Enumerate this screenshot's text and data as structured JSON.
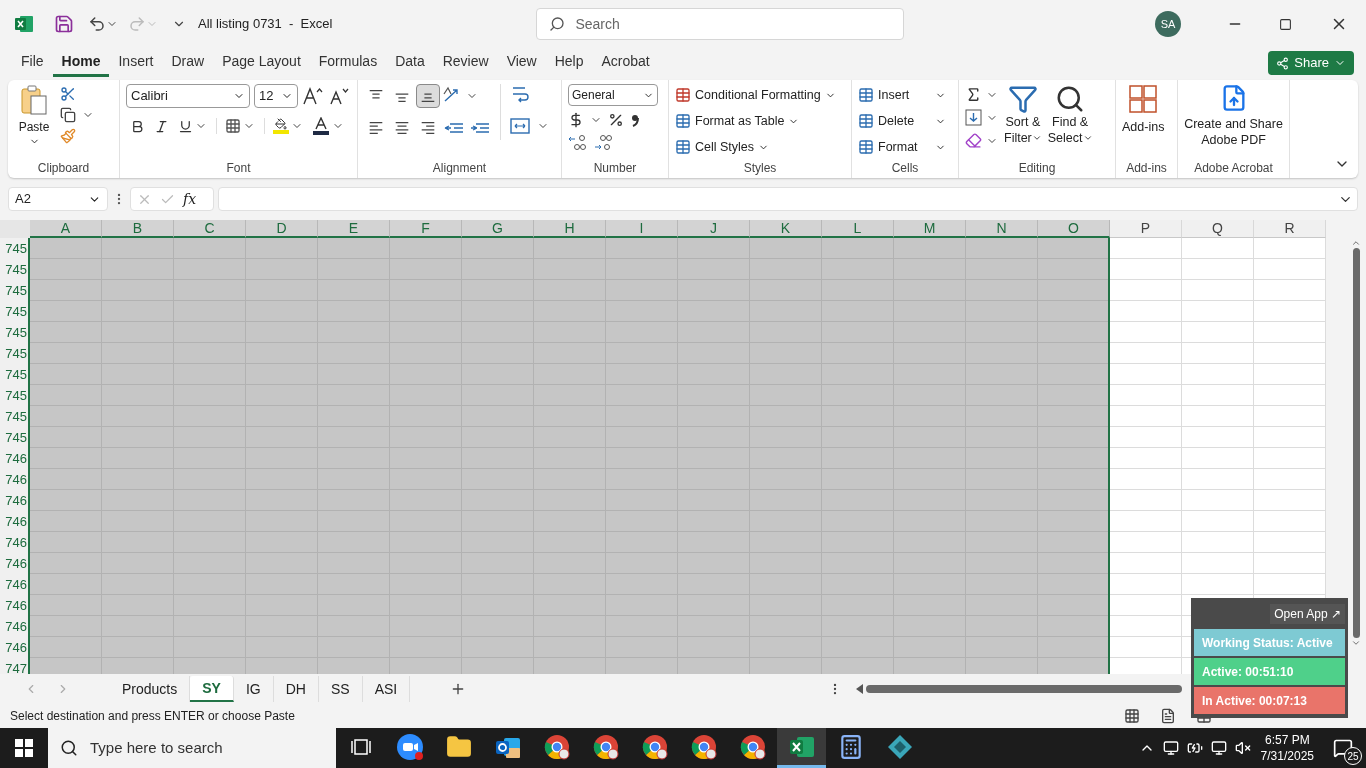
{
  "title_bar": {
    "title": "All listing 0731  -  Excel",
    "search_placeholder": "Search",
    "account_initials": "SA"
  },
  "menu_tabs": [
    {
      "label": "File",
      "selected": false
    },
    {
      "label": "Home",
      "selected": true
    },
    {
      "label": "Insert",
      "selected": false
    },
    {
      "label": "Draw",
      "selected": false
    },
    {
      "label": "Page Layout",
      "selected": false
    },
    {
      "label": "Formulas",
      "selected": false
    },
    {
      "label": "Data",
      "selected": false
    },
    {
      "label": "Review",
      "selected": false
    },
    {
      "label": "View",
      "selected": false
    },
    {
      "label": "Help",
      "selected": false
    },
    {
      "label": "Acrobat",
      "selected": false
    }
  ],
  "share_button": "Share",
  "ribbon": {
    "clipboard": {
      "paste": "Paste",
      "label": "Clipboard"
    },
    "font": {
      "font_name": "Calibri",
      "font_size": "12",
      "label": "Font"
    },
    "alignment": {
      "label": "Alignment",
      "vertical_align": [
        {
          "selected": false
        },
        {
          "selected": false
        },
        {
          "selected": true
        }
      ]
    },
    "number": {
      "format": "General",
      "label": "Number"
    },
    "styles": {
      "buttons": [
        "Conditional Formatting",
        "Format as Table",
        "Cell Styles"
      ],
      "label": "Styles"
    },
    "cells": {
      "buttons": [
        "Insert",
        "Delete",
        "Format"
      ],
      "label": "Cells"
    },
    "editing": {
      "sort_filter": [
        "Sort &",
        "Filter"
      ],
      "find_select": [
        "Find &",
        "Select"
      ],
      "label": "Editing"
    },
    "addins": {
      "button": "Add-ins",
      "label": "Add-ins"
    },
    "acrobat": {
      "button": [
        "Create and Share",
        "Adobe PDF"
      ],
      "label": "Adobe Acrobat"
    }
  },
  "formula_bar": {
    "name_box": "A2",
    "fx": "fx"
  },
  "columns": [
    {
      "label": "A",
      "selected": true
    },
    {
      "label": "B",
      "selected": true
    },
    {
      "label": "C",
      "selected": true
    },
    {
      "label": "D",
      "selected": true
    },
    {
      "label": "E",
      "selected": true
    },
    {
      "label": "F",
      "selected": true
    },
    {
      "label": "G",
      "selected": true
    },
    {
      "label": "H",
      "selected": true
    },
    {
      "label": "I",
      "selected": true
    },
    {
      "label": "J",
      "selected": true
    },
    {
      "label": "K",
      "selected": true
    },
    {
      "label": "L",
      "selected": true
    },
    {
      "label": "M",
      "selected": true
    },
    {
      "label": "N",
      "selected": true
    },
    {
      "label": "O",
      "selected": true
    },
    {
      "label": "P",
      "selected": false
    },
    {
      "label": "Q",
      "selected": false
    },
    {
      "label": "R",
      "selected": false
    }
  ],
  "rows": [
    "745",
    "745",
    "745",
    "745",
    "745",
    "745",
    "745",
    "745",
    "745",
    "745",
    "746",
    "746",
    "746",
    "746",
    "746",
    "746",
    "746",
    "746",
    "746",
    "746",
    "747"
  ],
  "sheets": [
    {
      "label": "Products",
      "selected": false
    },
    {
      "label": "SY",
      "selected": true
    },
    {
      "label": "IG",
      "selected": false
    },
    {
      "label": "DH",
      "selected": false
    },
    {
      "label": "SS",
      "selected": false
    },
    {
      "label": "ASI",
      "selected": false
    }
  ],
  "status_text": "Select destination and press ENTER or choose Paste",
  "tracker": {
    "open_app": "Open App ↗",
    "items": [
      {
        "text": "Working Status: Active",
        "color": "#7ecad3"
      },
      {
        "text": "Active: 00:51:10",
        "color": "#4fd08a"
      },
      {
        "text": "In Active: 00:07:13",
        "color": "#e9746a"
      }
    ]
  },
  "taskbar": {
    "search_placeholder": "Type here to search",
    "apps": [
      {
        "kind": "task_view",
        "selected": false
      },
      {
        "kind": "zoom",
        "selected": false
      },
      {
        "kind": "folder",
        "selected": false
      },
      {
        "kind": "outlook",
        "selected": false
      },
      {
        "kind": "chrome",
        "selected": false
      },
      {
        "kind": "chrome",
        "selected": false
      },
      {
        "kind": "chrome",
        "selected": false
      },
      {
        "kind": "chrome",
        "selected": false
      },
      {
        "kind": "chrome",
        "selected": false
      },
      {
        "kind": "excel",
        "selected": true
      },
      {
        "kind": "calculator",
        "selected": false
      },
      {
        "kind": "diamond",
        "selected": false
      }
    ],
    "time": "6:57 PM",
    "date": "7/31/2025",
    "notifications": "25"
  }
}
